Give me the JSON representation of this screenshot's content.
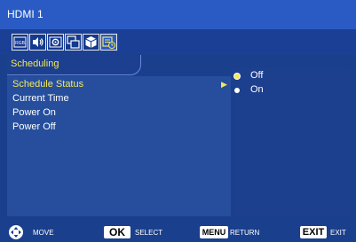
{
  "window": {
    "title": "HDMI 1"
  },
  "icon_bar": {
    "tabs": [
      {
        "name": "picture-icon",
        "glyph": "RGB"
      },
      {
        "name": "audio-icon",
        "glyph": ""
      },
      {
        "name": "setup-icon",
        "glyph": ""
      },
      {
        "name": "pip-icon",
        "glyph": ""
      },
      {
        "name": "option-icon",
        "glyph": ""
      },
      {
        "name": "scheduling-icon",
        "glyph": ""
      }
    ],
    "active_index": 5
  },
  "section": {
    "label": "Scheduling"
  },
  "menu": {
    "items": [
      {
        "label": "Schedule Status",
        "selected": true
      },
      {
        "label": "Current Time",
        "selected": false
      },
      {
        "label": "Power On",
        "selected": false
      },
      {
        "label": "Power Off",
        "selected": false
      }
    ]
  },
  "options": {
    "items": [
      {
        "label": "Off",
        "checked": true
      },
      {
        "label": "On",
        "checked": false
      }
    ]
  },
  "footer": {
    "move_label": "MOVE",
    "ok_key": "OK",
    "select_label": "SELECT",
    "menu_key": "MENU",
    "return_label": "RETURN",
    "exit_key": "EXIT",
    "exit_label": "EXIT"
  },
  "colors": {
    "background": "#1a3f8c",
    "title_bar": "#2a5bc4",
    "highlight_text": "#f2e85a",
    "left_panel": "#264e9d"
  }
}
